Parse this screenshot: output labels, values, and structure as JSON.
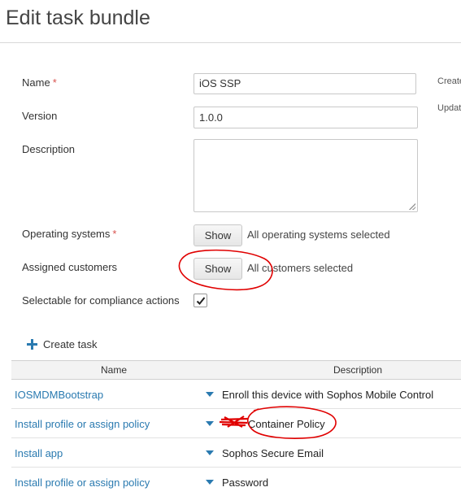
{
  "header": {
    "title": "Edit task bundle"
  },
  "form": {
    "name_label": "Name",
    "name_value": "iOS SSP",
    "version_label": "Version",
    "version_value": "1.0.0",
    "description_label": "Description",
    "description_value": "",
    "os_label": "Operating systems",
    "os_button": "Show",
    "os_note": "All operating systems selected",
    "customers_label": "Assigned customers",
    "customers_button": "Show",
    "customers_note": "All customers selected",
    "compliance_label": "Selectable for compliance actions",
    "compliance_checked": true,
    "required_mark": "*"
  },
  "side": {
    "created": "Create",
    "updated": "Updat"
  },
  "tasks": {
    "create_label": "Create task",
    "columns": {
      "name": "Name",
      "description": "Description"
    },
    "rows": [
      {
        "name": "IOSMDMBootstrap",
        "description": "Enroll this device with Sophos Mobile Control"
      },
      {
        "name": "Install profile or assign policy",
        "description": "Container Policy"
      },
      {
        "name": "Install app",
        "description": "Sophos Secure Email"
      },
      {
        "name": "Install profile or assign policy",
        "description": "Password"
      }
    ]
  },
  "colors": {
    "link": "#2a7ab0",
    "required": "#d9534f",
    "annotation": "#e00000"
  }
}
